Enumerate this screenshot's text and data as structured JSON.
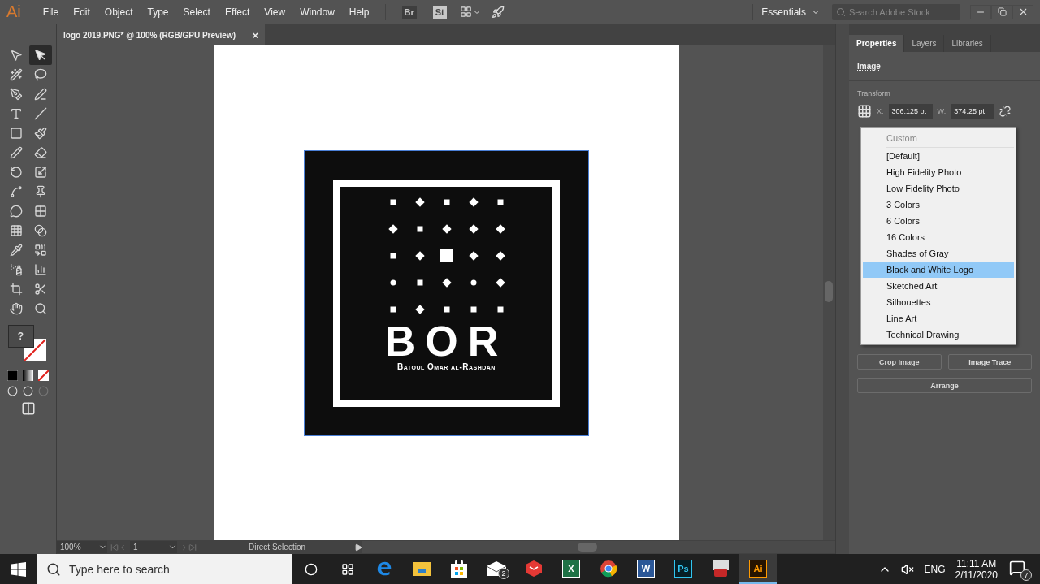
{
  "app": {
    "logo": "Ai",
    "menu": [
      "File",
      "Edit",
      "Object",
      "Type",
      "Select",
      "Effect",
      "View",
      "Window",
      "Help"
    ],
    "bridge": "Br",
    "stock": "St",
    "workspace": "Essentials",
    "search": {
      "placeholder": "Search Adobe Stock"
    }
  },
  "document_tab": {
    "title": "logo 2019.PNG* @ 100% (RGB/GPU Preview)",
    "close": "×"
  },
  "tools": [
    {
      "selected": false
    },
    {
      "selected": true
    },
    {
      "selected": false
    },
    {
      "selected": false
    },
    {
      "selected": false
    },
    {
      "selected": false
    },
    {
      "selected": false
    },
    {
      "selected": false
    },
    {
      "selected": false
    },
    {
      "selected": false
    },
    {
      "selected": false
    },
    {
      "selected": false
    },
    {
      "selected": false
    },
    {
      "selected": false
    },
    {
      "selected": false
    },
    {
      "selected": false
    },
    {
      "selected": false
    },
    {
      "selected": false
    },
    {
      "selected": false
    },
    {
      "selected": false
    },
    {
      "selected": false
    },
    {
      "selected": false
    },
    {
      "selected": false
    },
    {
      "selected": false
    },
    {
      "selected": false
    },
    {
      "selected": false
    },
    {
      "selected": false
    },
    {
      "selected": false
    }
  ],
  "fill_swatch": "?",
  "artwork": {
    "title": "BOR",
    "subtitle": "Batoul Omar al-Rashdan"
  },
  "status_bar": {
    "zoom": "100%",
    "artboard": "1",
    "tool": "Direct Selection"
  },
  "panel": {
    "tabs": [
      {
        "label": "Properties",
        "selected": true
      },
      {
        "label": "Layers",
        "selected": false
      },
      {
        "label": "Libraries",
        "selected": false
      }
    ],
    "section": "Image",
    "transform": {
      "label": "Transform",
      "fields": [
        {
          "label": "X:",
          "value": "306.125 pt"
        },
        {
          "label": "W:",
          "value": "374.25 pt"
        }
      ]
    },
    "buttons": [
      "Crop Image",
      "Image Trace"
    ],
    "arrange": "Arrange"
  },
  "preset_menu": {
    "header": "Custom",
    "items": [
      {
        "label": "[Default]",
        "selected": false
      },
      {
        "label": "High Fidelity Photo",
        "selected": false
      },
      {
        "label": "Low Fidelity Photo",
        "selected": false
      },
      {
        "label": "3 Colors",
        "selected": false
      },
      {
        "label": "6 Colors",
        "selected": false
      },
      {
        "label": "16 Colors",
        "selected": false
      },
      {
        "label": "Shades of Gray",
        "selected": false
      },
      {
        "label": "Black and White Logo",
        "selected": true
      },
      {
        "label": "Sketched Art",
        "selected": false
      },
      {
        "label": "Silhouettes",
        "selected": false
      },
      {
        "label": "Line Art",
        "selected": false
      },
      {
        "label": "Technical Drawing",
        "selected": false
      }
    ]
  },
  "taskbar": {
    "search": {
      "placeholder": "Type here to search"
    },
    "apps": [
      {
        "kind": "edge",
        "selected": false
      },
      {
        "kind": "explorer",
        "selected": false
      },
      {
        "kind": "store",
        "selected": false
      },
      {
        "kind": "mail",
        "badge": "2",
        "selected": false
      },
      {
        "kind": "sketchup",
        "selected": false
      },
      {
        "kind": "excel",
        "label": "X",
        "selected": false
      },
      {
        "kind": "chrome",
        "selected": false
      },
      {
        "kind": "word",
        "label": "W",
        "selected": false
      },
      {
        "kind": "photoshop",
        "label": "Ps",
        "selected": false
      },
      {
        "kind": "toolbox",
        "selected": false
      },
      {
        "kind": "illustrator",
        "label": "Ai",
        "selected": true
      }
    ],
    "language": "ENG",
    "time": "11:11 AM",
    "date": "2/11/2020",
    "notifications": "7"
  }
}
